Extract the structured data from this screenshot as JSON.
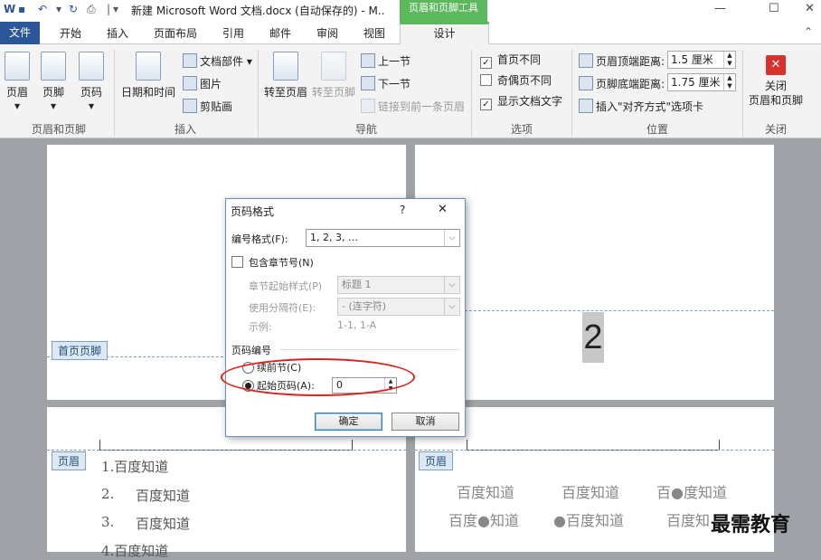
{
  "titlebar": {
    "title": "新建 Microsoft Word 文档.docx (自动保存的) - M..",
    "context_group": "页眉和页脚工具",
    "qat_separator": "|",
    "qat_dropdown": "▾",
    "min": "—",
    "max": "☐",
    "close": "✕"
  },
  "tabs": {
    "file": "文件",
    "items": [
      "开始",
      "插入",
      "页面布局",
      "引用",
      "邮件",
      "审阅",
      "视图"
    ],
    "design": "设计",
    "collapse": "⌃"
  },
  "ribbon": {
    "hf": {
      "header": "页眉",
      "footer": "页脚",
      "page_number": "页码",
      "label": "页眉和页脚",
      "arrow": "▾"
    },
    "insert": {
      "datetime": "日期和时间",
      "docparts": "文档部件",
      "picture": "图片",
      "clipart": "剪贴画",
      "label": "插入",
      "arrow": "▾"
    },
    "nav": {
      "goto_header": "转至页眉",
      "goto_footer": "转至页脚",
      "prev": "上一节",
      "next": "下一节",
      "link_prev": "链接到前一条页眉",
      "label": "导航"
    },
    "options": {
      "diff_first": "首页不同",
      "diff_oddeven": "奇偶页不同",
      "show_text": "显示文档文字",
      "check": "✓",
      "label": "选项"
    },
    "position": {
      "header_dist_label": "页眉顶端距离:",
      "header_dist": "1.5 厘米",
      "footer_dist_label": "页脚底端距离:",
      "footer_dist": "1.75 厘米",
      "insert_tab": "插入\"对齐方式\"选项卡",
      "label": "位置",
      "spin_up": "▲",
      "spin_down": "▼"
    },
    "close": {
      "button": "关闭\n页眉和页脚",
      "label": "关闭",
      "x": "✕"
    }
  },
  "document": {
    "first_footer_tag": "首页页脚",
    "header_tag": "页眉",
    "header_tag_right": "页眉",
    "page_number": "2",
    "left_lines": [
      "1.百度知道",
      "2.",
      "百度知道",
      "3.",
      "百度知道",
      "4.百度知道"
    ],
    "right_row1": [
      "百度知道",
      "百度知道",
      "百●度知道"
    ],
    "right_row2": [
      "百度●知道",
      "●百度知道",
      "百度知"
    ],
    "watermark": "最需教育"
  },
  "dialog": {
    "title": "页码格式",
    "help": "?",
    "close": "✕",
    "format_label": "编号格式(F):",
    "format_value": "1, 2, 3, …",
    "include_chapter": "包含章节号(N)",
    "chapter_style_label": "章节起始样式(P)",
    "chapter_style_value": "标题 1",
    "separator_label": "使用分隔符(E):",
    "separator_value": "-  (连字符)",
    "example_label": "示例:",
    "example_value": "1-1, 1-A",
    "numbering_section": "页码编号",
    "continue_label": "续前节(C)",
    "start_label": "起始页码(A):",
    "start_value": "0",
    "ok": "确定",
    "cancel": "取消",
    "drop": "⌵"
  },
  "colors": {
    "accent": "#2b579a",
    "context": "#5cb85c",
    "highlight_ring": "#d9231d"
  }
}
